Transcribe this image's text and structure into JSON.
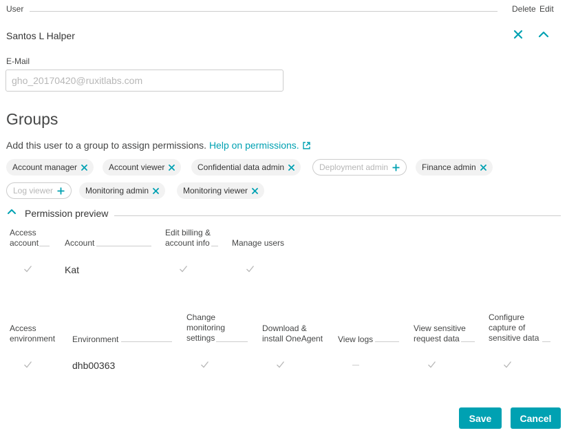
{
  "header": {
    "user_label": "User",
    "delete_label": "Delete",
    "edit_label": "Edit"
  },
  "user": {
    "name": "Santos L Halper",
    "email_label": "E-Mail",
    "email_value": "gho_20170420@ruxitlabs.com"
  },
  "groups": {
    "title": "Groups",
    "description": "Add this user to a group to assign permissions.",
    "help_link": "Help on permissions.",
    "chips": [
      {
        "label": "Account manager",
        "assigned": true
      },
      {
        "label": "Account viewer",
        "assigned": true
      },
      {
        "label": "Confidential data admin",
        "assigned": true
      },
      {
        "label": "Deployment admin",
        "assigned": false
      },
      {
        "label": "Finance admin",
        "assigned": true
      },
      {
        "label": "Log viewer",
        "assigned": false
      },
      {
        "label": "Monitoring admin",
        "assigned": true
      },
      {
        "label": "Monitoring viewer",
        "assigned": true
      }
    ]
  },
  "preview": {
    "title": "Permission preview",
    "account_table": {
      "headers": {
        "access": [
          "Access",
          "account"
        ],
        "account": "Account",
        "billing": [
          "Edit billing &",
          "account info"
        ],
        "manage": "Manage users"
      },
      "row": {
        "account": "Kat",
        "access": "check",
        "billing": "check",
        "manage": "check"
      }
    },
    "env_table": {
      "headers": {
        "access": [
          "Access",
          "environment"
        ],
        "environment": "Environment",
        "change": [
          "Change",
          "monitoring",
          "settings"
        ],
        "download": [
          "Download &",
          "install OneAgent"
        ],
        "logs": "View logs",
        "sensitive": [
          "View sensitive",
          "request data"
        ],
        "capture": [
          "Configure",
          "capture of",
          "sensitive data"
        ]
      },
      "row": {
        "environment": "dhb00363",
        "access": "check",
        "change": "check",
        "download": "check",
        "logs": "dash",
        "sensitive": "check",
        "capture": "check"
      }
    }
  },
  "actions": {
    "save": "Save",
    "cancel": "Cancel"
  },
  "colors": {
    "accent": "#00a1b2",
    "chip_bg": "#f2f2f2",
    "rule": "#cccccc",
    "check": "#b7b7b7"
  }
}
